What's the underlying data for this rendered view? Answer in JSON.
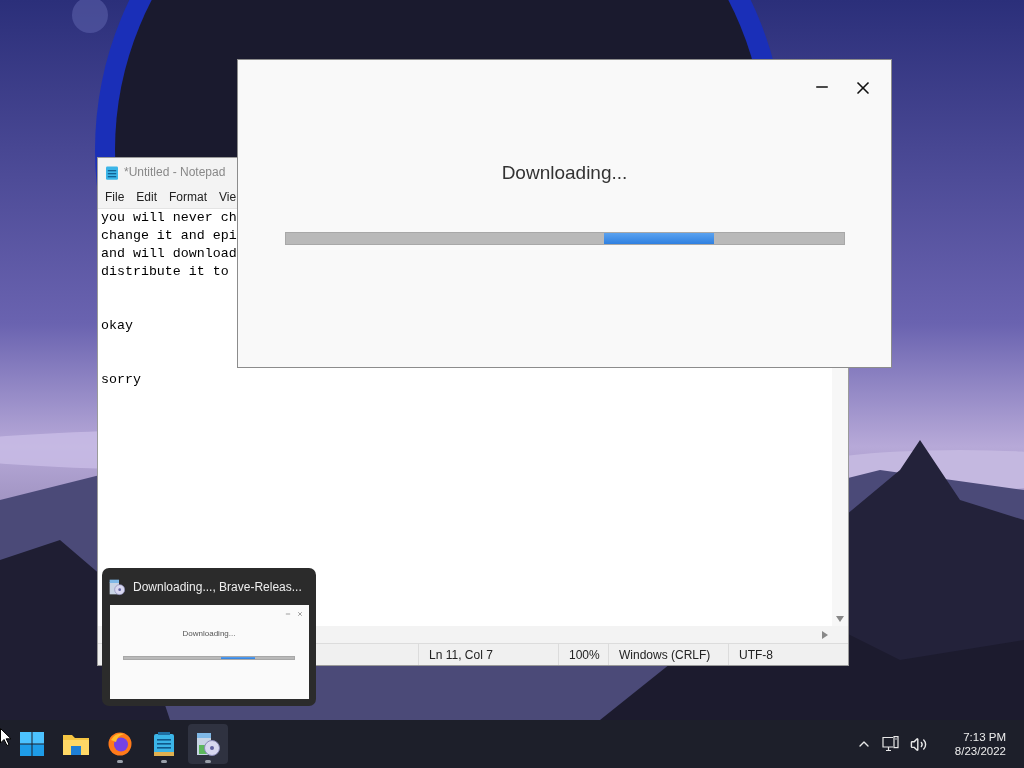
{
  "notepad": {
    "title": "*Untitled - Notepad",
    "menu": [
      "File",
      "Edit",
      "Format",
      "Vie"
    ],
    "paragraphs": [
      {
        "lines": [
          "you will never ch",
          "change it and epi",
          "and will download",
          "distribute it to"
        ]
      },
      {
        "lines": [
          "okay"
        ]
      },
      {
        "lines": [
          "sorry"
        ]
      }
    ],
    "status_bar": [
      "Ln 11, Col 7",
      "100%",
      "Windows (CRLF)",
      "UTF-8"
    ]
  },
  "dialog": {
    "title": "Downloading..."
  },
  "preview": {
    "title": "Downloading..., Brave-Releas...",
    "dialog_title": "Downloading..."
  },
  "taskbar": {
    "apps": [
      {
        "kind": "start",
        "running": false,
        "selected": false
      },
      {
        "kind": "explorer",
        "running": false,
        "selected": false
      },
      {
        "kind": "firefox",
        "running": true,
        "selected": false
      },
      {
        "kind": "notepad",
        "running": true,
        "selected": false
      },
      {
        "kind": "installer",
        "running": true,
        "selected": true
      }
    ],
    "clock": {
      "time": "7:13 PM",
      "date": "8/23/2022"
    }
  }
}
